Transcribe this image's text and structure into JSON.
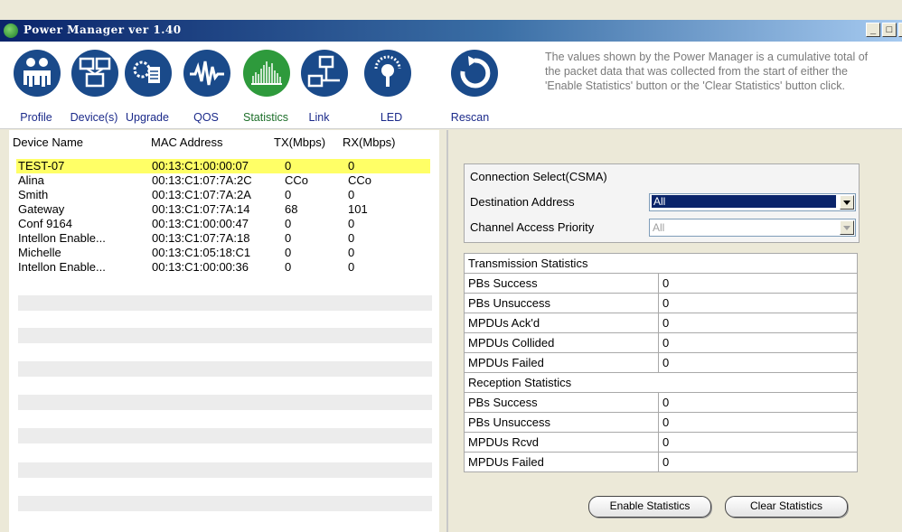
{
  "window": {
    "title": "Power Manager ver 1.40"
  },
  "toolbar": {
    "items": [
      {
        "label": "Profile",
        "icon": "people-icon"
      },
      {
        "label": "Device(s)",
        "icon": "devices-icon"
      },
      {
        "label": "Upgrade",
        "icon": "upgrade-icon"
      },
      {
        "label": "QOS",
        "icon": "waveform-icon"
      },
      {
        "label": "Statistics",
        "icon": "bar-graph-icon"
      },
      {
        "label": "Link",
        "icon": "network-link-icon"
      },
      {
        "label": "LED",
        "icon": "led-bulb-icon"
      },
      {
        "label": "Rescan",
        "icon": "rescan-icon"
      }
    ],
    "active": "Statistics",
    "info_text": "The values shown by the Power Manager is a cumulative total of the packet data that was collected from the start of either the 'Enable Statistics' button or the 'Clear Statistics' button click."
  },
  "device_list": {
    "headers": [
      "Device Name",
      "MAC Address",
      "TX(Mbps)",
      "RX(Mbps)"
    ],
    "rows": [
      {
        "name": "TEST-07",
        "mac": "00:13:C1:00:00:07",
        "tx": "0",
        "rx": "0"
      },
      {
        "name": "Alina",
        "mac": "00:13:C1:07:7A:2C",
        "tx": "CCo",
        "rx": "CCo"
      },
      {
        "name": "Smith",
        "mac": "00:13:C1:07:7A:2A",
        "tx": "0",
        "rx": "0"
      },
      {
        "name": "Gateway",
        "mac": "00:13:C1:07:7A:14",
        "tx": "68",
        "rx": "101"
      },
      {
        "name": "Conf 9164",
        "mac": "00:13:C1:00:00:47",
        "tx": "0",
        "rx": "0"
      },
      {
        "name": "Intellon Enable...",
        "mac": "00:13:C1:07:7A:18",
        "tx": "0",
        "rx": "0"
      },
      {
        "name": "Michelle",
        "mac": "00:13:C1:05:18:C1",
        "tx": "0",
        "rx": "0"
      },
      {
        "name": "Intellon Enable...",
        "mac": "00:13:C1:00:00:36",
        "tx": "0",
        "rx": "0"
      }
    ],
    "selected_row": 0
  },
  "connection": {
    "title": "Connection Select(CSMA)",
    "destination_label": "Destination Address",
    "destination_value": "All",
    "priority_label": "Channel Access Priority",
    "priority_value": "All"
  },
  "stats": {
    "transmission_title": "Transmission Statistics",
    "transmission": [
      {
        "label": "PBs Success",
        "value": "0"
      },
      {
        "label": "PBs Unsuccess",
        "value": "0"
      },
      {
        "label": "MPDUs Ack'd",
        "value": "0"
      },
      {
        "label": "MPDUs Collided",
        "value": "0"
      },
      {
        "label": "MPDUs Failed",
        "value": "0"
      }
    ],
    "reception_title": "Reception Statistics",
    "reception": [
      {
        "label": "PBs Success",
        "value": "0"
      },
      {
        "label": "PBs Unsuccess",
        "value": "0"
      },
      {
        "label": "MPDUs Rcvd",
        "value": "0"
      },
      {
        "label": "MPDUs Failed",
        "value": "0"
      }
    ]
  },
  "buttons": {
    "enable": "Enable Statistics",
    "clear": "Clear Statistics"
  },
  "colors": {
    "icon_blue": "#1a4a8a",
    "icon_green": "#2e9a3c",
    "selected_row": "#ffff66",
    "title_bar": "#0a246a"
  }
}
